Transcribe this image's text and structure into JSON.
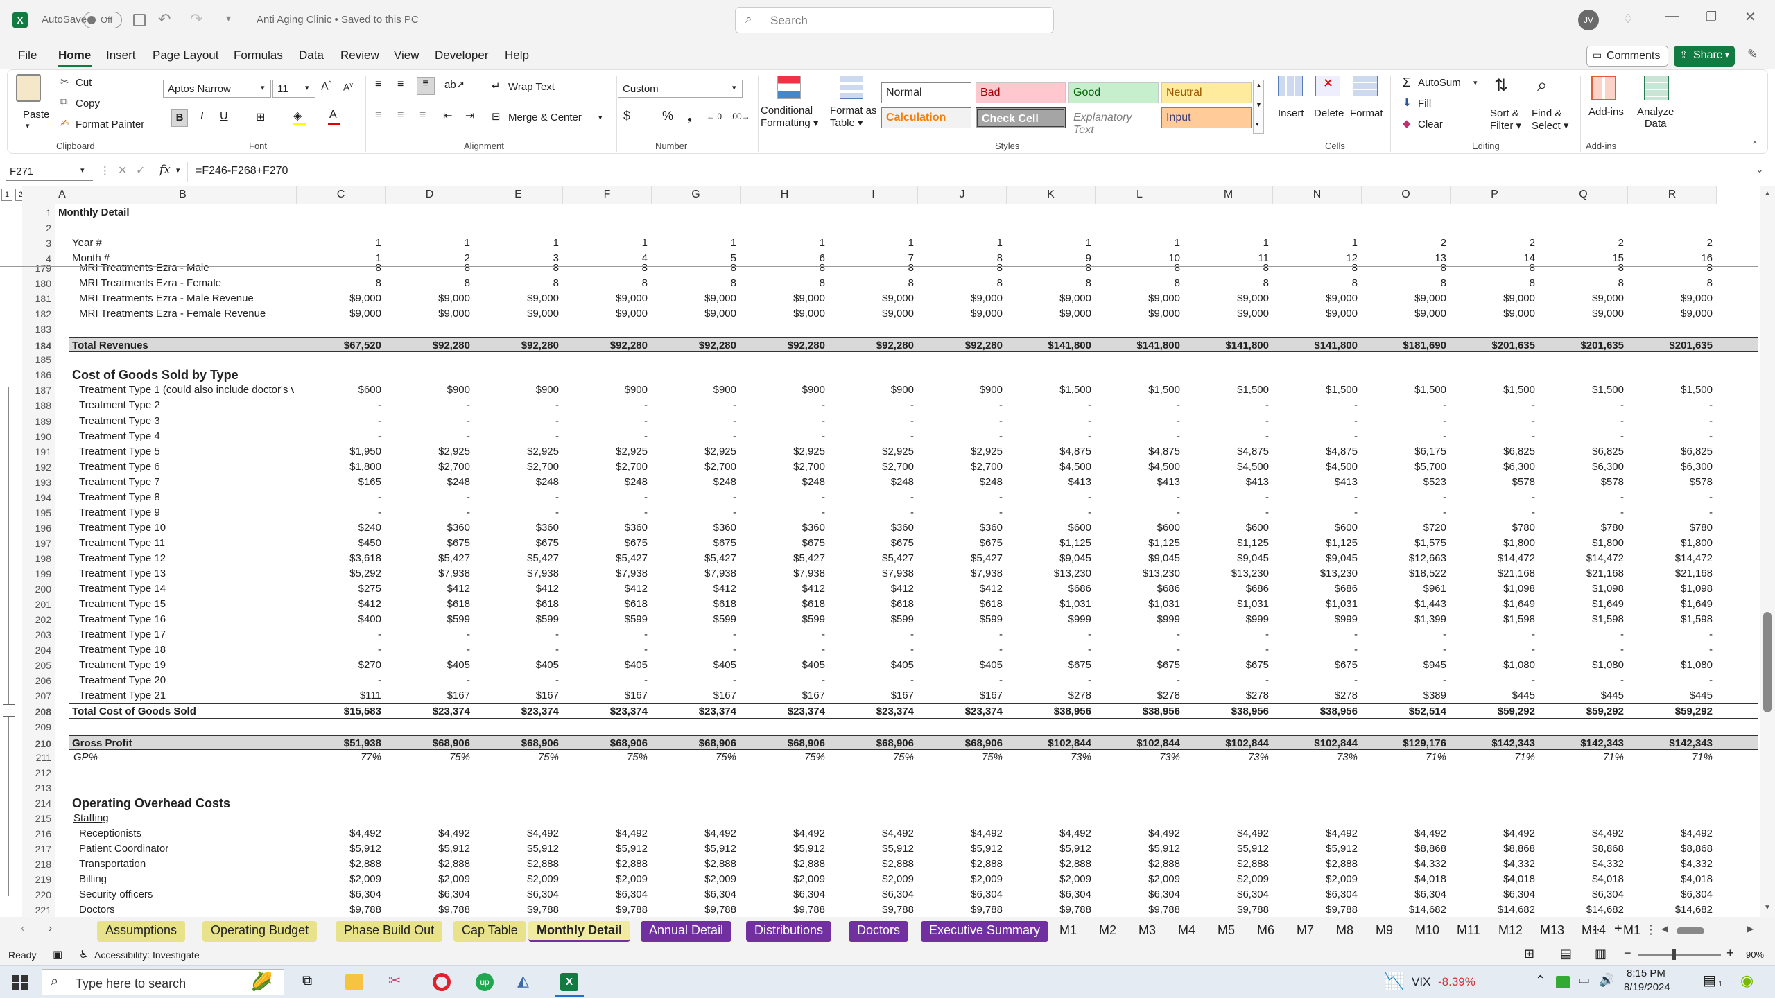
{
  "app": {
    "autosave_label": "AutoSave",
    "autosave_state": "Off",
    "doc_title": "Anti Aging Clinic • Saved to this PC",
    "search_placeholder": "Search",
    "user_initials": "JV"
  },
  "menu": {
    "items": [
      "File",
      "Home",
      "Insert",
      "Page Layout",
      "Formulas",
      "Data",
      "Review",
      "View",
      "Developer",
      "Help"
    ],
    "active": "Home",
    "comments": "Comments",
    "share": "Share"
  },
  "ribbon": {
    "clipboard": {
      "paste": "Paste",
      "cut": "Cut",
      "copy": "Copy",
      "format_painter": "Format Painter",
      "group": "Clipboard"
    },
    "font": {
      "name": "Aptos Narrow",
      "size": "11",
      "group": "Font"
    },
    "alignment": {
      "wrap": "Wrap Text",
      "merge": "Merge & Center",
      "group": "Alignment"
    },
    "number": {
      "format": "Custom",
      "group": "Number"
    },
    "styles": {
      "cond1": "Conditional",
      "cond2": "Formatting",
      "fmt1": "Format as",
      "fmt2": "Table",
      "normal": "Normal",
      "bad": "Bad",
      "good": "Good",
      "neutral": "Neutral",
      "calculation": "Calculation",
      "check": "Check Cell",
      "explanatory": "Explanatory Text",
      "input": "Input",
      "group": "Styles"
    },
    "cells": {
      "insert": "Insert",
      "delete": "Delete",
      "format": "Format",
      "group": "Cells"
    },
    "editing": {
      "autosum": "AutoSum",
      "fill": "Fill",
      "clear": "Clear",
      "sort1": "Sort &",
      "sort2": "Filter",
      "find1": "Find &",
      "find2": "Select",
      "group": "Editing"
    },
    "addins": {
      "addins": "Add-ins",
      "analyze1": "Analyze",
      "analyze2": "Data",
      "group": "Add-ins"
    }
  },
  "formula": {
    "namebox": "F271",
    "fx": "fx",
    "text": "=F246-F268+F270"
  },
  "columns": [
    "A",
    "B",
    "C",
    "D",
    "E",
    "F",
    "G",
    "H",
    "I",
    "J",
    "K",
    "L",
    "M",
    "N",
    "O",
    "P",
    "Q",
    "R"
  ],
  "header_rows": [
    {
      "n": "1",
      "label": "Monthly Detail",
      "style": "bold",
      "vals": []
    },
    {
      "n": "2",
      "label": "",
      "style": "",
      "vals": []
    },
    {
      "n": "3",
      "label": "Year #",
      "style": "",
      "vals": [
        "1",
        "1",
        "1",
        "1",
        "1",
        "1",
        "1",
        "1",
        "1",
        "1",
        "1",
        "1",
        "2",
        "2",
        "2",
        "2"
      ]
    },
    {
      "n": "4",
      "label": "Month #",
      "style": "",
      "vals": [
        "1",
        "2",
        "3",
        "4",
        "5",
        "6",
        "7",
        "8",
        "9",
        "10",
        "11",
        "12",
        "13",
        "14",
        "15",
        "16"
      ]
    }
  ],
  "rows": [
    {
      "n": "179",
      "label": "MRI Treatments Ezra - Male",
      "style": "ind2",
      "vals": [
        "8",
        "8",
        "8",
        "8",
        "8",
        "8",
        "8",
        "8",
        "8",
        "8",
        "8",
        "8",
        "8",
        "8",
        "8",
        "8"
      ]
    },
    {
      "n": "180",
      "label": "MRI Treatments Ezra - Female",
      "style": "ind2",
      "vals": [
        "8",
        "8",
        "8",
        "8",
        "8",
        "8",
        "8",
        "8",
        "8",
        "8",
        "8",
        "8",
        "8",
        "8",
        "8",
        "8"
      ]
    },
    {
      "n": "181",
      "label": "MRI Treatments Ezra - Male Revenue",
      "style": "ind2",
      "vals": [
        "$9,000",
        "$9,000",
        "$9,000",
        "$9,000",
        "$9,000",
        "$9,000",
        "$9,000",
        "$9,000",
        "$9,000",
        "$9,000",
        "$9,000",
        "$9,000",
        "$9,000",
        "$9,000",
        "$9,000",
        "$9,000"
      ]
    },
    {
      "n": "182",
      "label": "MRI Treatments Ezra - Female Revenue",
      "style": "ind2",
      "vals": [
        "$9,000",
        "$9,000",
        "$9,000",
        "$9,000",
        "$9,000",
        "$9,000",
        "$9,000",
        "$9,000",
        "$9,000",
        "$9,000",
        "$9,000",
        "$9,000",
        "$9,000",
        "$9,000",
        "$9,000",
        "$9,000"
      ]
    },
    {
      "n": "183",
      "label": "",
      "style": "",
      "vals": []
    },
    {
      "n": "184",
      "label": "Total Revenues",
      "style": "total",
      "vals": [
        "$67,520",
        "$92,280",
        "$92,280",
        "$92,280",
        "$92,280",
        "$92,280",
        "$92,280",
        "$92,280",
        "$141,800",
        "$141,800",
        "$141,800",
        "$141,800",
        "$181,690",
        "$201,635",
        "$201,635",
        "$201,635"
      ]
    },
    {
      "n": "185",
      "label": "",
      "style": "",
      "vals": []
    },
    {
      "n": "186",
      "label": "Cost of Goods Sold by Type",
      "style": "section",
      "vals": []
    },
    {
      "n": "187",
      "label": "Treatment Type 1 (could also include doctor's v",
      "style": "ind2",
      "vals": [
        "$600",
        "$900",
        "$900",
        "$900",
        "$900",
        "$900",
        "$900",
        "$900",
        "$1,500",
        "$1,500",
        "$1,500",
        "$1,500",
        "$1,500",
        "$1,500",
        "$1,500",
        "$1,500"
      ]
    },
    {
      "n": "188",
      "label": "Treatment Type 2",
      "style": "ind2",
      "vals": [
        "-",
        "-",
        "-",
        "-",
        "-",
        "-",
        "-",
        "-",
        "-",
        "-",
        "-",
        "-",
        "-",
        "-",
        "-",
        "-"
      ]
    },
    {
      "n": "189",
      "label": "Treatment Type 3",
      "style": "ind2",
      "vals": [
        "-",
        "-",
        "-",
        "-",
        "-",
        "-",
        "-",
        "-",
        "-",
        "-",
        "-",
        "-",
        "-",
        "-",
        "-",
        "-"
      ]
    },
    {
      "n": "190",
      "label": "Treatment Type 4",
      "style": "ind2",
      "vals": [
        "-",
        "-",
        "-",
        "-",
        "-",
        "-",
        "-",
        "-",
        "-",
        "-",
        "-",
        "-",
        "-",
        "-",
        "-",
        "-"
      ]
    },
    {
      "n": "191",
      "label": "Treatment Type 5",
      "style": "ind2",
      "vals": [
        "$1,950",
        "$2,925",
        "$2,925",
        "$2,925",
        "$2,925",
        "$2,925",
        "$2,925",
        "$2,925",
        "$4,875",
        "$4,875",
        "$4,875",
        "$4,875",
        "$6,175",
        "$6,825",
        "$6,825",
        "$6,825"
      ]
    },
    {
      "n": "192",
      "label": "Treatment Type 6",
      "style": "ind2",
      "vals": [
        "$1,800",
        "$2,700",
        "$2,700",
        "$2,700",
        "$2,700",
        "$2,700",
        "$2,700",
        "$2,700",
        "$4,500",
        "$4,500",
        "$4,500",
        "$4,500",
        "$5,700",
        "$6,300",
        "$6,300",
        "$6,300"
      ]
    },
    {
      "n": "193",
      "label": "Treatment Type 7",
      "style": "ind2",
      "vals": [
        "$165",
        "$248",
        "$248",
        "$248",
        "$248",
        "$248",
        "$248",
        "$248",
        "$413",
        "$413",
        "$413",
        "$413",
        "$523",
        "$578",
        "$578",
        "$578"
      ]
    },
    {
      "n": "194",
      "label": "Treatment Type 8",
      "style": "ind2",
      "vals": [
        "-",
        "-",
        "-",
        "-",
        "-",
        "-",
        "-",
        "-",
        "-",
        "-",
        "-",
        "-",
        "-",
        "-",
        "-",
        "-"
      ]
    },
    {
      "n": "195",
      "label": "Treatment Type 9",
      "style": "ind2",
      "vals": [
        "-",
        "-",
        "-",
        "-",
        "-",
        "-",
        "-",
        "-",
        "-",
        "-",
        "-",
        "-",
        "-",
        "-",
        "-",
        "-"
      ]
    },
    {
      "n": "196",
      "label": "Treatment Type 10",
      "style": "ind2",
      "vals": [
        "$240",
        "$360",
        "$360",
        "$360",
        "$360",
        "$360",
        "$360",
        "$360",
        "$600",
        "$600",
        "$600",
        "$600",
        "$720",
        "$780",
        "$780",
        "$780"
      ]
    },
    {
      "n": "197",
      "label": "Treatment Type 11",
      "style": "ind2",
      "vals": [
        "$450",
        "$675",
        "$675",
        "$675",
        "$675",
        "$675",
        "$675",
        "$675",
        "$1,125",
        "$1,125",
        "$1,125",
        "$1,125",
        "$1,575",
        "$1,800",
        "$1,800",
        "$1,800"
      ]
    },
    {
      "n": "198",
      "label": "Treatment Type 12",
      "style": "ind2",
      "vals": [
        "$3,618",
        "$5,427",
        "$5,427",
        "$5,427",
        "$5,427",
        "$5,427",
        "$5,427",
        "$5,427",
        "$9,045",
        "$9,045",
        "$9,045",
        "$9,045",
        "$12,663",
        "$14,472",
        "$14,472",
        "$14,472"
      ]
    },
    {
      "n": "199",
      "label": "Treatment Type 13",
      "style": "ind2",
      "vals": [
        "$5,292",
        "$7,938",
        "$7,938",
        "$7,938",
        "$7,938",
        "$7,938",
        "$7,938",
        "$7,938",
        "$13,230",
        "$13,230",
        "$13,230",
        "$13,230",
        "$18,522",
        "$21,168",
        "$21,168",
        "$21,168"
      ]
    },
    {
      "n": "200",
      "label": "Treatment Type 14",
      "style": "ind2",
      "vals": [
        "$275",
        "$412",
        "$412",
        "$412",
        "$412",
        "$412",
        "$412",
        "$412",
        "$686",
        "$686",
        "$686",
        "$686",
        "$961",
        "$1,098",
        "$1,098",
        "$1,098"
      ]
    },
    {
      "n": "201",
      "label": "Treatment Type 15",
      "style": "ind2",
      "vals": [
        "$412",
        "$618",
        "$618",
        "$618",
        "$618",
        "$618",
        "$618",
        "$618",
        "$1,031",
        "$1,031",
        "$1,031",
        "$1,031",
        "$1,443",
        "$1,649",
        "$1,649",
        "$1,649"
      ]
    },
    {
      "n": "202",
      "label": "Treatment Type 16",
      "style": "ind2",
      "vals": [
        "$400",
        "$599",
        "$599",
        "$599",
        "$599",
        "$599",
        "$599",
        "$599",
        "$999",
        "$999",
        "$999",
        "$999",
        "$1,399",
        "$1,598",
        "$1,598",
        "$1,598"
      ]
    },
    {
      "n": "203",
      "label": "Treatment Type 17",
      "style": "ind2",
      "vals": [
        "-",
        "-",
        "-",
        "-",
        "-",
        "-",
        "-",
        "-",
        "-",
        "-",
        "-",
        "-",
        "-",
        "-",
        "-",
        "-"
      ]
    },
    {
      "n": "204",
      "label": "Treatment Type 18",
      "style": "ind2",
      "vals": [
        "-",
        "-",
        "-",
        "-",
        "-",
        "-",
        "-",
        "-",
        "-",
        "-",
        "-",
        "-",
        "-",
        "-",
        "-",
        "-"
      ]
    },
    {
      "n": "205",
      "label": "Treatment Type 19",
      "style": "ind2",
      "vals": [
        "$270",
        "$405",
        "$405",
        "$405",
        "$405",
        "$405",
        "$405",
        "$405",
        "$675",
        "$675",
        "$675",
        "$675",
        "$945",
        "$1,080",
        "$1,080",
        "$1,080"
      ]
    },
    {
      "n": "206",
      "label": "Treatment Type 20",
      "style": "ind2",
      "vals": [
        "-",
        "-",
        "-",
        "-",
        "-",
        "-",
        "-",
        "-",
        "-",
        "-",
        "-",
        "-",
        "-",
        "-",
        "-",
        "-"
      ]
    },
    {
      "n": "207",
      "label": "Treatment Type 21",
      "style": "ind2",
      "vals": [
        "$111",
        "$167",
        "$167",
        "$167",
        "$167",
        "$167",
        "$167",
        "$167",
        "$278",
        "$278",
        "$278",
        "$278",
        "$389",
        "$445",
        "$445",
        "$445"
      ]
    },
    {
      "n": "208",
      "label": "Total Cost of Goods Sold",
      "style": "cogs",
      "vals": [
        "$15,583",
        "$23,374",
        "$23,374",
        "$23,374",
        "$23,374",
        "$23,374",
        "$23,374",
        "$23,374",
        "$38,956",
        "$38,956",
        "$38,956",
        "$38,956",
        "$52,514",
        "$59,292",
        "$59,292",
        "$59,292"
      ]
    },
    {
      "n": "209",
      "label": "",
      "style": "",
      "vals": []
    },
    {
      "n": "210",
      "label": "Gross Profit",
      "style": "total",
      "vals": [
        "$51,938",
        "$68,906",
        "$68,906",
        "$68,906",
        "$68,906",
        "$68,906",
        "$68,906",
        "$68,906",
        "$102,844",
        "$102,844",
        "$102,844",
        "$102,844",
        "$129,176",
        "$142,343",
        "$142,343",
        "$142,343"
      ]
    },
    {
      "n": "211",
      "label": "GP%",
      "style": "italic",
      "vals": [
        "77%",
        "75%",
        "75%",
        "75%",
        "75%",
        "75%",
        "75%",
        "75%",
        "73%",
        "73%",
        "73%",
        "73%",
        "71%",
        "71%",
        "71%",
        "71%"
      ]
    },
    {
      "n": "212",
      "label": "",
      "style": "",
      "vals": []
    },
    {
      "n": "213",
      "label": "",
      "style": "",
      "vals": []
    },
    {
      "n": "214",
      "label": "Operating Overhead Costs",
      "style": "section",
      "vals": []
    },
    {
      "n": "215",
      "label": "Staffing",
      "style": "underline",
      "vals": []
    },
    {
      "n": "216",
      "label": "Receptionists",
      "style": "ind2",
      "vals": [
        "$4,492",
        "$4,492",
        "$4,492",
        "$4,492",
        "$4,492",
        "$4,492",
        "$4,492",
        "$4,492",
        "$4,492",
        "$4,492",
        "$4,492",
        "$4,492",
        "$4,492",
        "$4,492",
        "$4,492",
        "$4,492"
      ]
    },
    {
      "n": "217",
      "label": "Patient Coordinator",
      "style": "ind2",
      "vals": [
        "$5,912",
        "$5,912",
        "$5,912",
        "$5,912",
        "$5,912",
        "$5,912",
        "$5,912",
        "$5,912",
        "$5,912",
        "$5,912",
        "$5,912",
        "$5,912",
        "$8,868",
        "$8,868",
        "$8,868",
        "$8,868"
      ]
    },
    {
      "n": "218",
      "label": "Transportation",
      "style": "ind2",
      "vals": [
        "$2,888",
        "$2,888",
        "$2,888",
        "$2,888",
        "$2,888",
        "$2,888",
        "$2,888",
        "$2,888",
        "$2,888",
        "$2,888",
        "$2,888",
        "$2,888",
        "$4,332",
        "$4,332",
        "$4,332",
        "$4,332"
      ]
    },
    {
      "n": "219",
      "label": "Billing",
      "style": "ind2",
      "vals": [
        "$2,009",
        "$2,009",
        "$2,009",
        "$2,009",
        "$2,009",
        "$2,009",
        "$2,009",
        "$2,009",
        "$2,009",
        "$2,009",
        "$2,009",
        "$2,009",
        "$4,018",
        "$4,018",
        "$4,018",
        "$4,018"
      ]
    },
    {
      "n": "220",
      "label": "Security officers",
      "style": "ind2",
      "vals": [
        "$6,304",
        "$6,304",
        "$6,304",
        "$6,304",
        "$6,304",
        "$6,304",
        "$6,304",
        "$6,304",
        "$6,304",
        "$6,304",
        "$6,304",
        "$6,304",
        "$6,304",
        "$6,304",
        "$6,304",
        "$6,304"
      ]
    },
    {
      "n": "221",
      "label": "Doctors",
      "style": "ind2",
      "vals": [
        "$9,788",
        "$9,788",
        "$9,788",
        "$9,788",
        "$9,788",
        "$9,788",
        "$9,788",
        "$9,788",
        "$9,788",
        "$9,788",
        "$9,788",
        "$9,788",
        "$14,682",
        "$14,682",
        "$14,682",
        "$14,682"
      ]
    }
  ],
  "tabs": [
    {
      "label": "Assumptions",
      "kind": "A"
    },
    {
      "label": "Operating Budget",
      "kind": "A"
    },
    {
      "label": "Phase Build Out",
      "kind": "A"
    },
    {
      "label": "Cap Table",
      "kind": "A"
    },
    {
      "label": "Monthly Detail",
      "kind": "Sel"
    },
    {
      "label": "Annual Detail",
      "kind": "P"
    },
    {
      "label": "Distributions",
      "kind": "P"
    },
    {
      "label": "Doctors",
      "kind": "P"
    },
    {
      "label": "Executive Summary",
      "kind": "P"
    },
    {
      "label": "M1",
      "kind": "M"
    },
    {
      "label": "M2",
      "kind": "M"
    },
    {
      "label": "M3",
      "kind": "M"
    },
    {
      "label": "M4",
      "kind": "M"
    },
    {
      "label": "M5",
      "kind": "M"
    },
    {
      "label": "M6",
      "kind": "M"
    },
    {
      "label": "M7",
      "kind": "M"
    },
    {
      "label": "M8",
      "kind": "M"
    },
    {
      "label": "M9",
      "kind": "M"
    },
    {
      "label": "M10",
      "kind": "M"
    },
    {
      "label": "M11",
      "kind": "M"
    },
    {
      "label": "M12",
      "kind": "M"
    },
    {
      "label": "M13",
      "kind": "M"
    },
    {
      "label": "M14",
      "kind": "M"
    },
    {
      "label": "M1",
      "kind": "M"
    }
  ],
  "status": {
    "ready": "Ready",
    "accessibility": "Accessibility: Investigate",
    "zoom": "90%"
  },
  "taskbar": {
    "search_placeholder": "Type here to search",
    "vix_label": "VIX",
    "vix_change": "-8.39%",
    "time": "8:15 PM",
    "date": "8/19/2024",
    "notif_count": "1"
  },
  "colors": {
    "excel_green": "#107c41",
    "purple_tab": "#7030a0",
    "yellow_tab": "#e8e38a",
    "vix_red": "#d13438"
  }
}
